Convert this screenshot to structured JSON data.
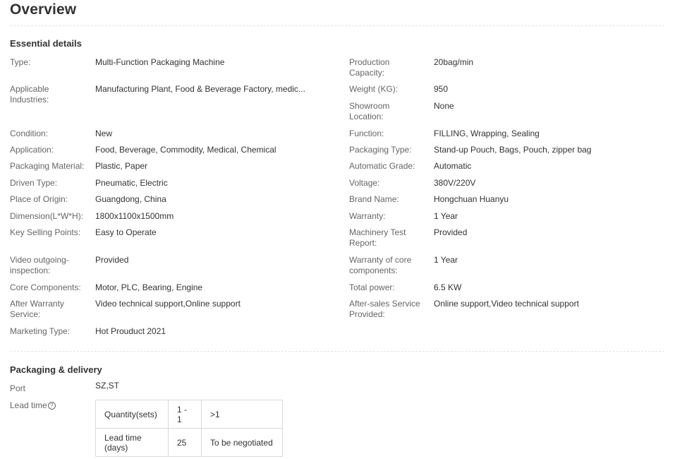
{
  "page": {
    "title": "Overview"
  },
  "essential": {
    "heading": "Essential details",
    "left": [
      {
        "label": "Type:",
        "value": "Multi-Function Packaging Machine"
      },
      {
        "label": "Applicable Industries:",
        "value": "Manufacturing Plant, Food & Beverage Factory, medic..."
      },
      {
        "label": "Condition:",
        "value": "New"
      },
      {
        "label": "Application:",
        "value": "Food, Beverage, Commodity, Medical, Chemical"
      },
      {
        "label": "Packaging Material:",
        "value": "Plastic, Paper"
      },
      {
        "label": "Driven Type:",
        "value": "Pneumatic, Electric"
      },
      {
        "label": "Place of Origin:",
        "value": "Guangdong, China"
      },
      {
        "label": "Dimension(L*W*H):",
        "value": "1800x1100x1500mm"
      },
      {
        "label": "Key Selling Points:",
        "value": "Easy to Operate"
      },
      {
        "label": "Video outgoing-inspection:",
        "value": "Provided"
      },
      {
        "label": "Core Components:",
        "value": "Motor, PLC, Bearing, Engine"
      },
      {
        "label": "After Warranty Service:",
        "value": "Video technical support,Online support"
      },
      {
        "label": "Marketing Type:",
        "value": "Hot Prouduct 2021"
      }
    ],
    "right": [
      {
        "label": "Production Capacity:",
        "value": "20bag/min"
      },
      {
        "label": "Weight (KG):",
        "value": "950"
      },
      {
        "label": "Showroom Location:",
        "value": "None"
      },
      {
        "label": "Function:",
        "value": "FILLING, Wrapping, Sealing"
      },
      {
        "label": "Packaging Type:",
        "value": "Stand-up Pouch, Bags, Pouch, zipper bag"
      },
      {
        "label": "Automatic Grade:",
        "value": "Automatic"
      },
      {
        "label": "Voltage:",
        "value": "380V/220V"
      },
      {
        "label": "Brand Name:",
        "value": "Hongchuan Huanyu"
      },
      {
        "label": "Warranty:",
        "value": "1 Year"
      },
      {
        "label": "Machinery Test Report:",
        "value": "Provided"
      },
      {
        "label": "Warranty of core components:",
        "value": "1 Year"
      },
      {
        "label": "Total power:",
        "value": "6.5 KW"
      },
      {
        "label": "After-sales Service Provided:",
        "value": "Online support,Video technical support"
      }
    ]
  },
  "packaging": {
    "heading": "Packaging & delivery",
    "port_label": "Port",
    "port_value": "SZ,ST",
    "lead_label": "Lead time",
    "help_icon": "?",
    "table": {
      "rows": [
        [
          "Quantity(sets)",
          "1 - 1",
          ">1"
        ],
        [
          "Lead time (days)",
          "25",
          "To be negotiated"
        ]
      ]
    }
  }
}
